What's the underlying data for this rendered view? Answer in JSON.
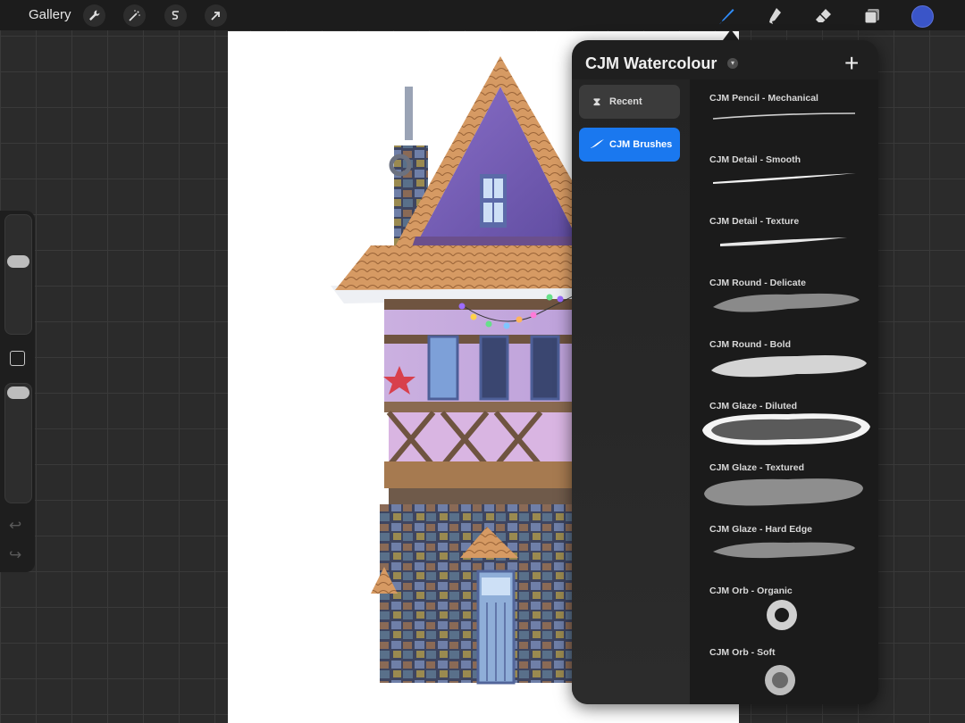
{
  "topbar": {
    "gallery_label": "Gallery",
    "tools_left": [
      "wrench-icon",
      "magic-wand-icon",
      "selection-icon",
      "transform-icon"
    ],
    "tools_right": [
      "brush-icon",
      "smudge-icon",
      "eraser-icon",
      "layers-icon"
    ],
    "current_color": "#3a55c8",
    "accent_color": "#1a78ef"
  },
  "sidebar": {
    "icons": [
      "brush-size-slider",
      "modify-button-icon",
      "opacity-slider",
      "undo-icon",
      "redo-icon"
    ]
  },
  "brush_library": {
    "title": "CJM Watercolour",
    "sets": [
      {
        "label": "Recent",
        "icon": "hourglass-icon"
      },
      {
        "label": "CJM Brushes",
        "icon": "brush-stroke-icon"
      }
    ],
    "brushes": [
      {
        "name": "CJM Pencil - Mechanical"
      },
      {
        "name": "CJM Detail - Smooth"
      },
      {
        "name": "CJM Detail - Texture"
      },
      {
        "name": "CJM Round - Delicate"
      },
      {
        "name": "CJM Round - Bold"
      },
      {
        "name": "CJM Glaze - Diluted"
      },
      {
        "name": "CJM Glaze - Textured"
      },
      {
        "name": "CJM Glaze - Hard Edge"
      },
      {
        "name": "CJM Orb - Organic"
      },
      {
        "name": "CJM Orb - Soft"
      }
    ]
  }
}
